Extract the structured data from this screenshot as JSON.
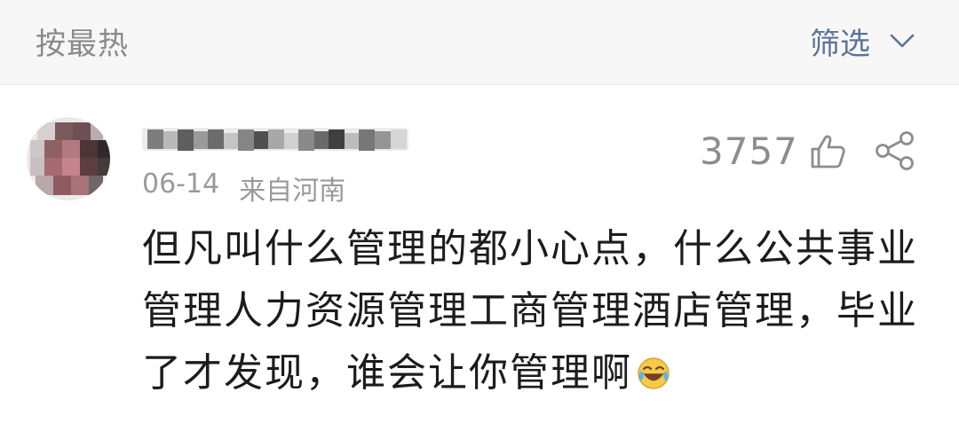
{
  "header": {
    "sort_label": "按最热",
    "filter_label": "筛选",
    "filter_icon": "chevron-down-icon"
  },
  "comment": {
    "username": "",
    "date": "06-14",
    "location": "来自河南",
    "like_count": "3757",
    "like_icon": "thumbs-up-icon",
    "share_icon": "share-icon",
    "text_line_1": "但凡叫什么管理的都小心点，什么公共事业",
    "text_line_2": "管理人力资源管理工商管理酒店管理，毕业",
    "text_line_3": "了才发现，谁会让你管理啊",
    "emoji": "laughing-crying-emoji"
  },
  "colors": {
    "topbar_bg": "#f7f7f7",
    "filter_text": "#5a7396",
    "muted_text": "#8a8a8a",
    "body_text": "#1c1c1c"
  }
}
